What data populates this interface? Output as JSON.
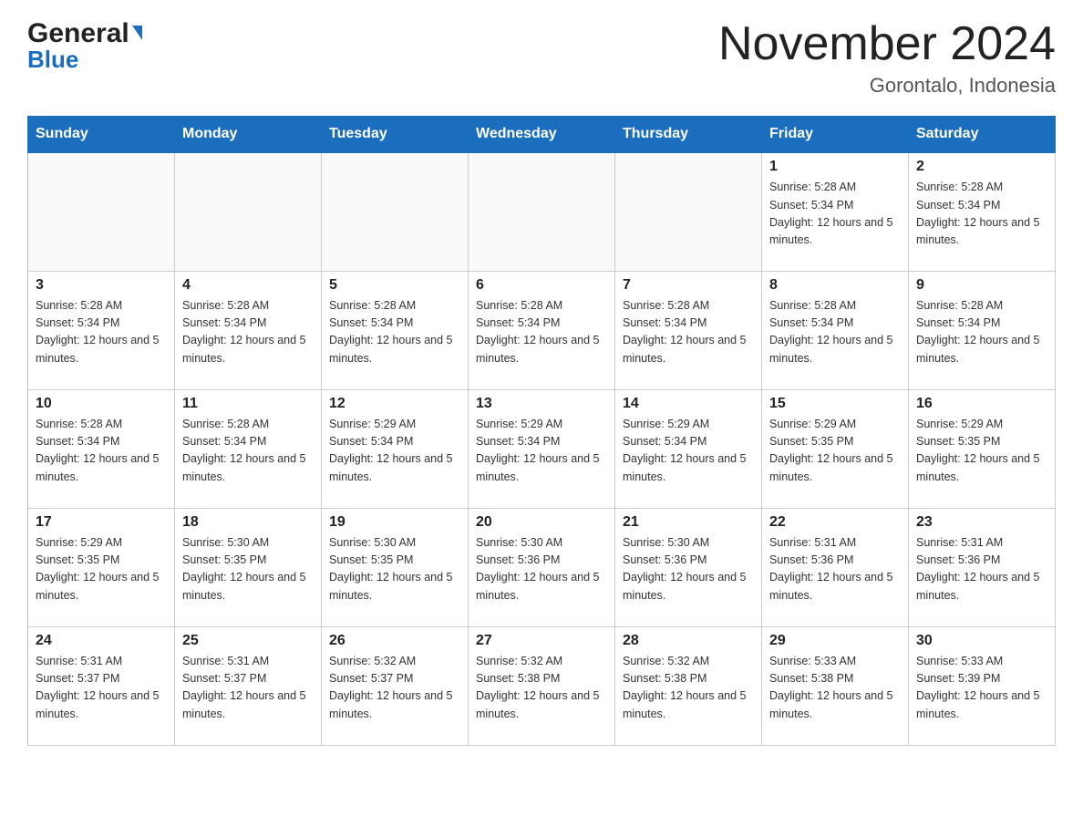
{
  "header": {
    "logo_general": "General",
    "logo_blue": "Blue",
    "title": "November 2024",
    "location": "Gorontalo, Indonesia"
  },
  "weekdays": [
    "Sunday",
    "Monday",
    "Tuesday",
    "Wednesday",
    "Thursday",
    "Friday",
    "Saturday"
  ],
  "weeks": [
    [
      {
        "day": "",
        "sunrise": "",
        "sunset": "",
        "daylight": ""
      },
      {
        "day": "",
        "sunrise": "",
        "sunset": "",
        "daylight": ""
      },
      {
        "day": "",
        "sunrise": "",
        "sunset": "",
        "daylight": ""
      },
      {
        "day": "",
        "sunrise": "",
        "sunset": "",
        "daylight": ""
      },
      {
        "day": "",
        "sunrise": "",
        "sunset": "",
        "daylight": ""
      },
      {
        "day": "1",
        "sunrise": "Sunrise: 5:28 AM",
        "sunset": "Sunset: 5:34 PM",
        "daylight": "Daylight: 12 hours and 5 minutes."
      },
      {
        "day": "2",
        "sunrise": "Sunrise: 5:28 AM",
        "sunset": "Sunset: 5:34 PM",
        "daylight": "Daylight: 12 hours and 5 minutes."
      }
    ],
    [
      {
        "day": "3",
        "sunrise": "Sunrise: 5:28 AM",
        "sunset": "Sunset: 5:34 PM",
        "daylight": "Daylight: 12 hours and 5 minutes."
      },
      {
        "day": "4",
        "sunrise": "Sunrise: 5:28 AM",
        "sunset": "Sunset: 5:34 PM",
        "daylight": "Daylight: 12 hours and 5 minutes."
      },
      {
        "day": "5",
        "sunrise": "Sunrise: 5:28 AM",
        "sunset": "Sunset: 5:34 PM",
        "daylight": "Daylight: 12 hours and 5 minutes."
      },
      {
        "day": "6",
        "sunrise": "Sunrise: 5:28 AM",
        "sunset": "Sunset: 5:34 PM",
        "daylight": "Daylight: 12 hours and 5 minutes."
      },
      {
        "day": "7",
        "sunrise": "Sunrise: 5:28 AM",
        "sunset": "Sunset: 5:34 PM",
        "daylight": "Daylight: 12 hours and 5 minutes."
      },
      {
        "day": "8",
        "sunrise": "Sunrise: 5:28 AM",
        "sunset": "Sunset: 5:34 PM",
        "daylight": "Daylight: 12 hours and 5 minutes."
      },
      {
        "day": "9",
        "sunrise": "Sunrise: 5:28 AM",
        "sunset": "Sunset: 5:34 PM",
        "daylight": "Daylight: 12 hours and 5 minutes."
      }
    ],
    [
      {
        "day": "10",
        "sunrise": "Sunrise: 5:28 AM",
        "sunset": "Sunset: 5:34 PM",
        "daylight": "Daylight: 12 hours and 5 minutes."
      },
      {
        "day": "11",
        "sunrise": "Sunrise: 5:28 AM",
        "sunset": "Sunset: 5:34 PM",
        "daylight": "Daylight: 12 hours and 5 minutes."
      },
      {
        "day": "12",
        "sunrise": "Sunrise: 5:29 AM",
        "sunset": "Sunset: 5:34 PM",
        "daylight": "Daylight: 12 hours and 5 minutes."
      },
      {
        "day": "13",
        "sunrise": "Sunrise: 5:29 AM",
        "sunset": "Sunset: 5:34 PM",
        "daylight": "Daylight: 12 hours and 5 minutes."
      },
      {
        "day": "14",
        "sunrise": "Sunrise: 5:29 AM",
        "sunset": "Sunset: 5:34 PM",
        "daylight": "Daylight: 12 hours and 5 minutes."
      },
      {
        "day": "15",
        "sunrise": "Sunrise: 5:29 AM",
        "sunset": "Sunset: 5:35 PM",
        "daylight": "Daylight: 12 hours and 5 minutes."
      },
      {
        "day": "16",
        "sunrise": "Sunrise: 5:29 AM",
        "sunset": "Sunset: 5:35 PM",
        "daylight": "Daylight: 12 hours and 5 minutes."
      }
    ],
    [
      {
        "day": "17",
        "sunrise": "Sunrise: 5:29 AM",
        "sunset": "Sunset: 5:35 PM",
        "daylight": "Daylight: 12 hours and 5 minutes."
      },
      {
        "day": "18",
        "sunrise": "Sunrise: 5:30 AM",
        "sunset": "Sunset: 5:35 PM",
        "daylight": "Daylight: 12 hours and 5 minutes."
      },
      {
        "day": "19",
        "sunrise": "Sunrise: 5:30 AM",
        "sunset": "Sunset: 5:35 PM",
        "daylight": "Daylight: 12 hours and 5 minutes."
      },
      {
        "day": "20",
        "sunrise": "Sunrise: 5:30 AM",
        "sunset": "Sunset: 5:36 PM",
        "daylight": "Daylight: 12 hours and 5 minutes."
      },
      {
        "day": "21",
        "sunrise": "Sunrise: 5:30 AM",
        "sunset": "Sunset: 5:36 PM",
        "daylight": "Daylight: 12 hours and 5 minutes."
      },
      {
        "day": "22",
        "sunrise": "Sunrise: 5:31 AM",
        "sunset": "Sunset: 5:36 PM",
        "daylight": "Daylight: 12 hours and 5 minutes."
      },
      {
        "day": "23",
        "sunrise": "Sunrise: 5:31 AM",
        "sunset": "Sunset: 5:36 PM",
        "daylight": "Daylight: 12 hours and 5 minutes."
      }
    ],
    [
      {
        "day": "24",
        "sunrise": "Sunrise: 5:31 AM",
        "sunset": "Sunset: 5:37 PM",
        "daylight": "Daylight: 12 hours and 5 minutes."
      },
      {
        "day": "25",
        "sunrise": "Sunrise: 5:31 AM",
        "sunset": "Sunset: 5:37 PM",
        "daylight": "Daylight: 12 hours and 5 minutes."
      },
      {
        "day": "26",
        "sunrise": "Sunrise: 5:32 AM",
        "sunset": "Sunset: 5:37 PM",
        "daylight": "Daylight: 12 hours and 5 minutes."
      },
      {
        "day": "27",
        "sunrise": "Sunrise: 5:32 AM",
        "sunset": "Sunset: 5:38 PM",
        "daylight": "Daylight: 12 hours and 5 minutes."
      },
      {
        "day": "28",
        "sunrise": "Sunrise: 5:32 AM",
        "sunset": "Sunset: 5:38 PM",
        "daylight": "Daylight: 12 hours and 5 minutes."
      },
      {
        "day": "29",
        "sunrise": "Sunrise: 5:33 AM",
        "sunset": "Sunset: 5:38 PM",
        "daylight": "Daylight: 12 hours and 5 minutes."
      },
      {
        "day": "30",
        "sunrise": "Sunrise: 5:33 AM",
        "sunset": "Sunset: 5:39 PM",
        "daylight": "Daylight: 12 hours and 5 minutes."
      }
    ]
  ]
}
